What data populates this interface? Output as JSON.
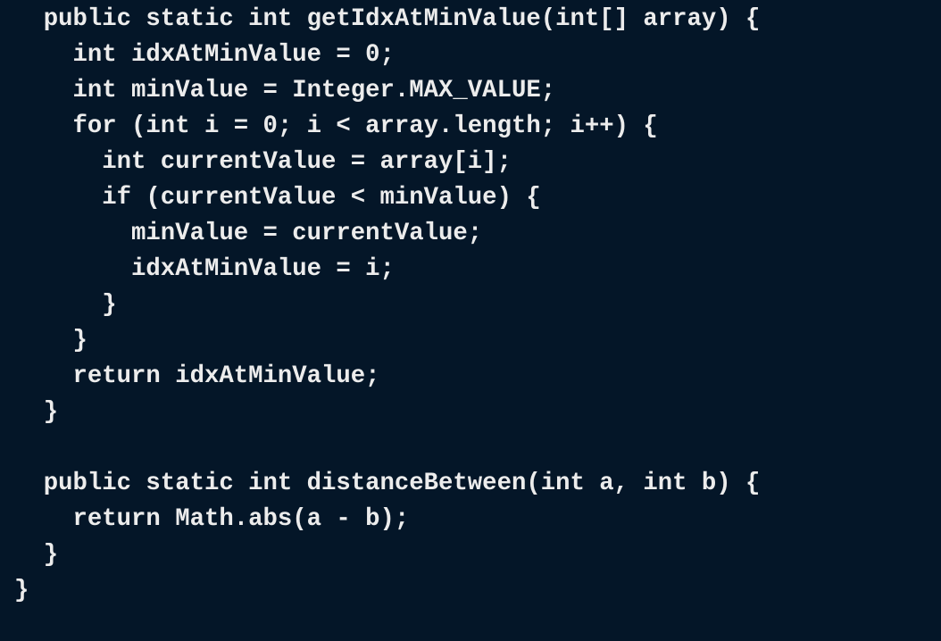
{
  "code": {
    "lines": [
      "  public static int getIdxAtMinValue(int[] array) {",
      "    int idxAtMinValue = 0;",
      "    int minValue = Integer.MAX_VALUE;",
      "    for (int i = 0; i < array.length; i++) {",
      "      int currentValue = array[i];",
      "      if (currentValue < minValue) {",
      "        minValue = currentValue;",
      "        idxAtMinValue = i;",
      "      }",
      "    }",
      "    return idxAtMinValue;",
      "  }",
      "",
      "  public static int distanceBetween(int a, int b) {",
      "    return Math.abs(a - b);",
      "  }",
      "}"
    ]
  }
}
